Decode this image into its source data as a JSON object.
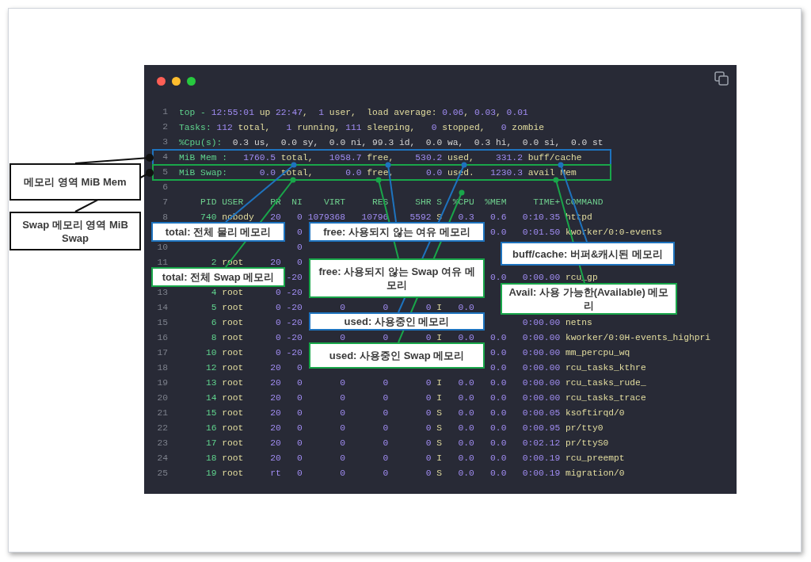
{
  "terminal": {
    "lines": [
      {
        "number": "1",
        "kind": "summary",
        "segments": [
          {
            "kind": "label",
            "text": "top - "
          },
          {
            "kind": "num",
            "text": "12:55:01"
          },
          {
            "kind": "text",
            "text": " up "
          },
          {
            "kind": "num",
            "text": "22:47"
          },
          {
            "kind": "text",
            "text": ",  "
          },
          {
            "kind": "num",
            "text": "1"
          },
          {
            "kind": "text",
            "text": " user,  load average: "
          },
          {
            "kind": "num",
            "text": "0.06"
          },
          {
            "kind": "text",
            "text": ", "
          },
          {
            "kind": "num",
            "text": "0.03"
          },
          {
            "kind": "text",
            "text": ", "
          },
          {
            "kind": "num",
            "text": "0.01"
          }
        ]
      },
      {
        "number": "2",
        "kind": "summary",
        "segments": [
          {
            "kind": "label",
            "text": "Tasks: "
          },
          {
            "kind": "num",
            "text": "112"
          },
          {
            "kind": "text",
            "text": " total,   "
          },
          {
            "kind": "num",
            "text": "1"
          },
          {
            "kind": "text",
            "text": " running, "
          },
          {
            "kind": "num",
            "text": "111"
          },
          {
            "kind": "text",
            "text": " sleeping,   "
          },
          {
            "kind": "num",
            "text": "0"
          },
          {
            "kind": "text",
            "text": " stopped,   "
          },
          {
            "kind": "num",
            "text": "0"
          },
          {
            "kind": "text",
            "text": " zombie"
          }
        ]
      },
      {
        "number": "3",
        "kind": "summary",
        "segments": [
          {
            "kind": "label",
            "text": "%Cpu(s):"
          },
          {
            "kind": "plain",
            "text": "  0.3 us,  0.0 sy,  0.0 ni, 99.3 id,  0.0 wa,  0.3 hi,  0.0 si,  0.0 st"
          }
        ]
      },
      {
        "number": "4",
        "kind": "summary",
        "color": "#1e73be",
        "segments": [
          {
            "kind": "label",
            "text": "MiB Mem :"
          },
          {
            "kind": "num",
            "text": "   1760.5"
          },
          {
            "kind": "text",
            "text": " total,"
          },
          {
            "kind": "num",
            "text": "   1058.7"
          },
          {
            "kind": "text",
            "text": " free,"
          },
          {
            "kind": "num",
            "text": "    530.2"
          },
          {
            "kind": "text",
            "text": " used,"
          },
          {
            "kind": "num",
            "text": "    331.2"
          },
          {
            "kind": "text",
            "text": " buff/cache"
          }
        ]
      },
      {
        "number": "5",
        "kind": "summary",
        "color": "#19a64a",
        "segments": [
          {
            "kind": "label",
            "text": "MiB Swap:"
          },
          {
            "kind": "num",
            "text": "      0.0"
          },
          {
            "kind": "text",
            "text": " total,"
          },
          {
            "kind": "num",
            "text": "      0.0"
          },
          {
            "kind": "text",
            "text": " free,"
          },
          {
            "kind": "num",
            "text": "      0.0"
          },
          {
            "kind": "text",
            "text": " used."
          },
          {
            "kind": "num",
            "text": "   1230.3"
          },
          {
            "kind": "text",
            "text": " avail Mem"
          }
        ]
      },
      {
        "number": "6",
        "kind": "blank"
      },
      {
        "number": "7",
        "kind": "header",
        "cells": {
          "pid": "PID",
          "user": "USER",
          "pr": "PR",
          "ni": "NI",
          "virt": "VIRT",
          "res": "RES",
          "shr": "SHR",
          "s": "S",
          "cpu": "%CPU",
          "mem": "%MEM",
          "time": "TIME+",
          "command": "COMMAND"
        }
      },
      {
        "number": "8",
        "kind": "process",
        "cells": {
          "pid": "740",
          "user": "nobody",
          "pr": "20",
          "ni": "0",
          "virt": "1079368",
          "res": "10796",
          "shr": "5592",
          "s": "S",
          "cpu": "0.3",
          "mem": "0.6",
          "time": "0:10.35",
          "command": "httpd"
        }
      },
      {
        "kind": "process",
        "cells": {
          "ni": "0",
          "mem": "0.0",
          "time": "0:01.50",
          "command": "kworker/0:0-events"
        }
      },
      {
        "number": "10",
        "kind": "process",
        "cells": {
          "ni": "0"
        }
      },
      {
        "number": "11",
        "kind": "process",
        "cells": {
          "pid": "2",
          "user": "root",
          "pr": "20",
          "ni": "0"
        }
      },
      {
        "kind": "process",
        "cells": {
          "ni": "-20",
          "mem": "0.0",
          "time": "0:00.00",
          "command": "rcu_gp"
        }
      },
      {
        "number": "13",
        "kind": "process",
        "cells": {
          "pid": "4",
          "user": "root",
          "pr": "0",
          "ni": "-20"
        }
      },
      {
        "number": "14",
        "kind": "process",
        "cells": {
          "pid": "5",
          "user": "root",
          "pr": "0",
          "ni": "-20",
          "virt": "0",
          "res": "0",
          "shr": "0",
          "s": "I",
          "cpu": "0.0"
        }
      },
      {
        "number": "15",
        "kind": "process",
        "cells": {
          "pid": "6",
          "user": "root",
          "pr": "0",
          "ni": "-20",
          "time": "0:00.00",
          "command": "netns"
        }
      },
      {
        "number": "16",
        "kind": "process",
        "cells": {
          "pid": "8",
          "user": "root",
          "pr": "0",
          "ni": "-20",
          "virt": "0",
          "res": "0",
          "shr": "0",
          "s": "I",
          "cpu": "0.0",
          "mem": "0.0",
          "time": "0:00.00",
          "command": "kworker/0:0H-events_highpri"
        }
      },
      {
        "number": "17",
        "kind": "process",
        "cells": {
          "pid": "10",
          "user": "root",
          "pr": "0",
          "ni": "-20",
          "mem": "0.0",
          "time": "0:00.00",
          "command": "mm_percpu_wq"
        }
      },
      {
        "number": "18",
        "kind": "process",
        "cells": {
          "pid": "12",
          "user": "root",
          "pr": "20",
          "ni": "0",
          "mem": "0.0",
          "time": "0:00.00",
          "command": "rcu_tasks_kthre"
        }
      },
      {
        "number": "19",
        "kind": "process",
        "cells": {
          "pid": "13",
          "user": "root",
          "pr": "20",
          "ni": "0",
          "virt": "0",
          "res": "0",
          "shr": "0",
          "s": "I",
          "cpu": "0.0",
          "mem": "0.0",
          "time": "0:00.00",
          "command": "rcu_tasks_rude_"
        }
      },
      {
        "number": "20",
        "kind": "process",
        "cells": {
          "pid": "14",
          "user": "root",
          "pr": "20",
          "ni": "0",
          "virt": "0",
          "res": "0",
          "shr": "0",
          "s": "I",
          "cpu": "0.0",
          "mem": "0.0",
          "time": "0:00.00",
          "command": "rcu_tasks_trace"
        }
      },
      {
        "number": "21",
        "kind": "process",
        "cells": {
          "pid": "15",
          "user": "root",
          "pr": "20",
          "ni": "0",
          "virt": "0",
          "res": "0",
          "shr": "0",
          "s": "S",
          "cpu": "0.0",
          "mem": "0.0",
          "time": "0:00.05",
          "command": "ksoftirqd/0"
        }
      },
      {
        "number": "22",
        "kind": "process",
        "cells": {
          "pid": "16",
          "user": "root",
          "pr": "20",
          "ni": "0",
          "virt": "0",
          "res": "0",
          "shr": "0",
          "s": "S",
          "cpu": "0.0",
          "mem": "0.0",
          "time": "0:00.95",
          "command": "pr/tty0"
        }
      },
      {
        "number": "23",
        "kind": "process",
        "cells": {
          "pid": "17",
          "user": "root",
          "pr": "20",
          "ni": "0",
          "virt": "0",
          "res": "0",
          "shr": "0",
          "s": "S",
          "cpu": "0.0",
          "mem": "0.0",
          "time": "0:02.12",
          "command": "pr/ttyS0"
        }
      },
      {
        "number": "24",
        "kind": "process",
        "cells": {
          "pid": "18",
          "user": "root",
          "pr": "20",
          "ni": "0",
          "virt": "0",
          "res": "0",
          "shr": "0",
          "s": "I",
          "cpu": "0.0",
          "mem": "0.0",
          "time": "0:00.19",
          "command": "rcu_preempt"
        }
      },
      {
        "number": "25",
        "kind": "process",
        "cells": {
          "pid": "19",
          "user": "root",
          "pr": "rt",
          "ni": "0",
          "virt": "0",
          "res": "0",
          "shr": "0",
          "s": "S",
          "cpu": "0.0",
          "mem": "0.0",
          "time": "0:00.19",
          "command": "migration/0"
        }
      }
    ]
  },
  "callouts": [
    {
      "kind": "area",
      "text": "메모리 영역 MiB Mem"
    },
    {
      "kind": "area",
      "text": "Swap 메모리 영역 MiB Swap"
    },
    {
      "kind": "memory",
      "text": "total: 전체 물리 메모리"
    },
    {
      "kind": "memory",
      "text": "free: 사용되지 않는 여유 메모리"
    },
    {
      "kind": "swap",
      "text": "total: 전체 Swap 메모리"
    },
    {
      "kind": "swap",
      "text": "free: 사용되지 않는 Swap 여유 메모리"
    },
    {
      "kind": "memory",
      "text": "used: 사용중인 메모리"
    },
    {
      "kind": "swap",
      "text": "used: 사용중인 Swap 메모리"
    },
    {
      "kind": "memory",
      "text": "buff/cache: 버퍼&캐시된 메모리"
    },
    {
      "kind": "swap",
      "text": "Avail: 사용 가능한(Available) 메모리"
    }
  ]
}
